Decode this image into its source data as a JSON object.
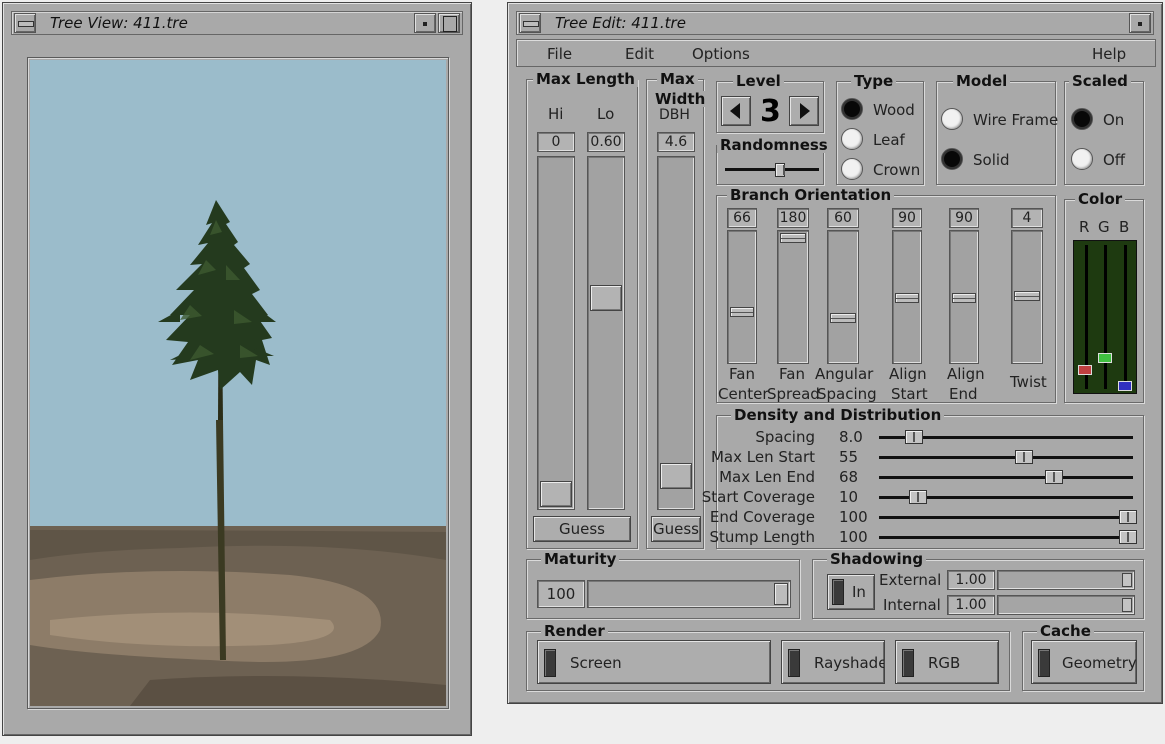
{
  "tree_view": {
    "title": "Tree View: 411.tre",
    "sky_color": "#9bbccb",
    "ground_color": "#6d6152"
  },
  "tree_edit": {
    "title": "Tree Edit: 411.tre",
    "menu": {
      "file": "File",
      "edit": "Edit",
      "options": "Options",
      "help": "Help"
    },
    "max_length": {
      "title": "Max Length",
      "hi_label": "Hi",
      "lo_label": "Lo",
      "hi_value": "0",
      "lo_value": "0.60",
      "guess": "Guess"
    },
    "max_width": {
      "title_line1": "Max",
      "title_line2": "Width",
      "dbh_label": "DBH",
      "value": "4.6",
      "guess": "Guess"
    },
    "level": {
      "title": "Level",
      "value": "3"
    },
    "randomness": {
      "title": "Randomness",
      "level": 0.62
    },
    "type": {
      "title": "Type",
      "wood": "Wood",
      "leaf": "Leaf",
      "crown": "Crown",
      "selected": "Wood"
    },
    "model": {
      "title": "Model",
      "wire_frame": "Wire Frame",
      "solid": "Solid",
      "selected": "Solid"
    },
    "scaled": {
      "title": "Scaled",
      "on": "On",
      "off": "Off",
      "selected": "On"
    },
    "branch_orientation": {
      "title": "Branch Orientation",
      "sliders": [
        {
          "value": "66",
          "label1": "Fan",
          "label2": "Center"
        },
        {
          "value": "180",
          "label1": "Fan",
          "label2": "Spread"
        },
        {
          "value": "60",
          "label1": "Angular",
          "label2": "Spacing"
        },
        {
          "value": "90",
          "label1": "Align",
          "label2": "Start"
        },
        {
          "value": "90",
          "label1": "Align",
          "label2": "End"
        },
        {
          "value": "4",
          "label1": "",
          "label2": "Twist"
        }
      ]
    },
    "color": {
      "title": "Color",
      "r": "R",
      "g": "G",
      "b": "B",
      "r_swatch": "#c04040",
      "g_swatch": "#40c040",
      "b_swatch": "#3030c0"
    },
    "density": {
      "title": "Density and Distribution",
      "rows": [
        {
          "label": "Spacing",
          "value": "8.0"
        },
        {
          "label": "Max Len Start",
          "value": "55"
        },
        {
          "label": "Max Len End",
          "value": "68"
        },
        {
          "label": "Start Coverage",
          "value": "10"
        },
        {
          "label": "End Coverage",
          "value": "100"
        },
        {
          "label": "Stump Length",
          "value": "100"
        }
      ]
    },
    "maturity": {
      "title": "Maturity",
      "value": "100"
    },
    "shadowing": {
      "title": "Shadowing",
      "in_label": "In",
      "external_label": "External",
      "external_value": "1.00",
      "internal_label": "Internal",
      "internal_value": "1.00"
    },
    "render": {
      "title": "Render",
      "screen": "Screen",
      "rayshade": "Rayshade",
      "rgb": "RGB"
    },
    "cache": {
      "title": "Cache",
      "geometry": "Geometry"
    }
  }
}
